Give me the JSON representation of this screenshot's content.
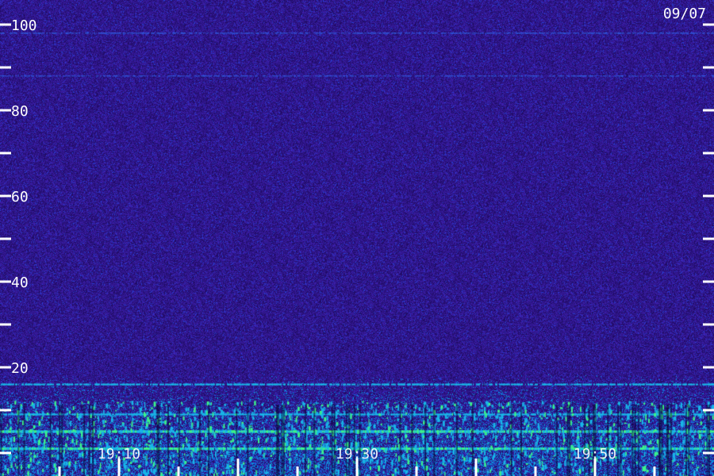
{
  "date_label": "09/07",
  "colors": {
    "background": "#2a0f78",
    "noise_low": "#1a0a55",
    "noise_high": "#3a2aa8",
    "band_cyan": "#19b6e8",
    "band_green": "#3cf58a",
    "tick": "#ffffff"
  },
  "chart_data": {
    "type": "heatmap",
    "title": "",
    "xlabel": "",
    "ylabel": "",
    "ylim": [
      0,
      100
    ],
    "y_tick_labels": [
      {
        "value": 20,
        "label": "20"
      },
      {
        "value": 40,
        "label": "40"
      },
      {
        "value": 60,
        "label": "60"
      },
      {
        "value": 80,
        "label": "80"
      },
      {
        "value": 100,
        "label": "100"
      }
    ],
    "y_minor_ticks": [
      0,
      10,
      30,
      50,
      70,
      90
    ],
    "x_tick_labels": [
      {
        "value": "19:10",
        "label": "19:10"
      },
      {
        "value": "19:30",
        "label": "19:30"
      },
      {
        "value": "19:50",
        "label": "19:50"
      }
    ],
    "x_ticks": [
      "19:00",
      "19:05",
      "19:10",
      "19:15",
      "19:20",
      "19:25",
      "19:30",
      "19:35",
      "19:40",
      "19:45",
      "19:50",
      "19:55",
      "20:00"
    ],
    "bands": [
      {
        "name": "strong",
        "y": 1,
        "intensity": 1.0
      },
      {
        "name": "green-line",
        "y": 5,
        "intensity": 0.9
      },
      {
        "name": "cyan-line",
        "y": 9,
        "intensity": 0.7
      },
      {
        "name": "upper-edge",
        "y": 16,
        "intensity": 0.5
      },
      {
        "name": "faint-line",
        "y": 98,
        "intensity": 0.4
      },
      {
        "name": "faint-line-2",
        "y": 88,
        "intensity": 0.25
      }
    ]
  }
}
